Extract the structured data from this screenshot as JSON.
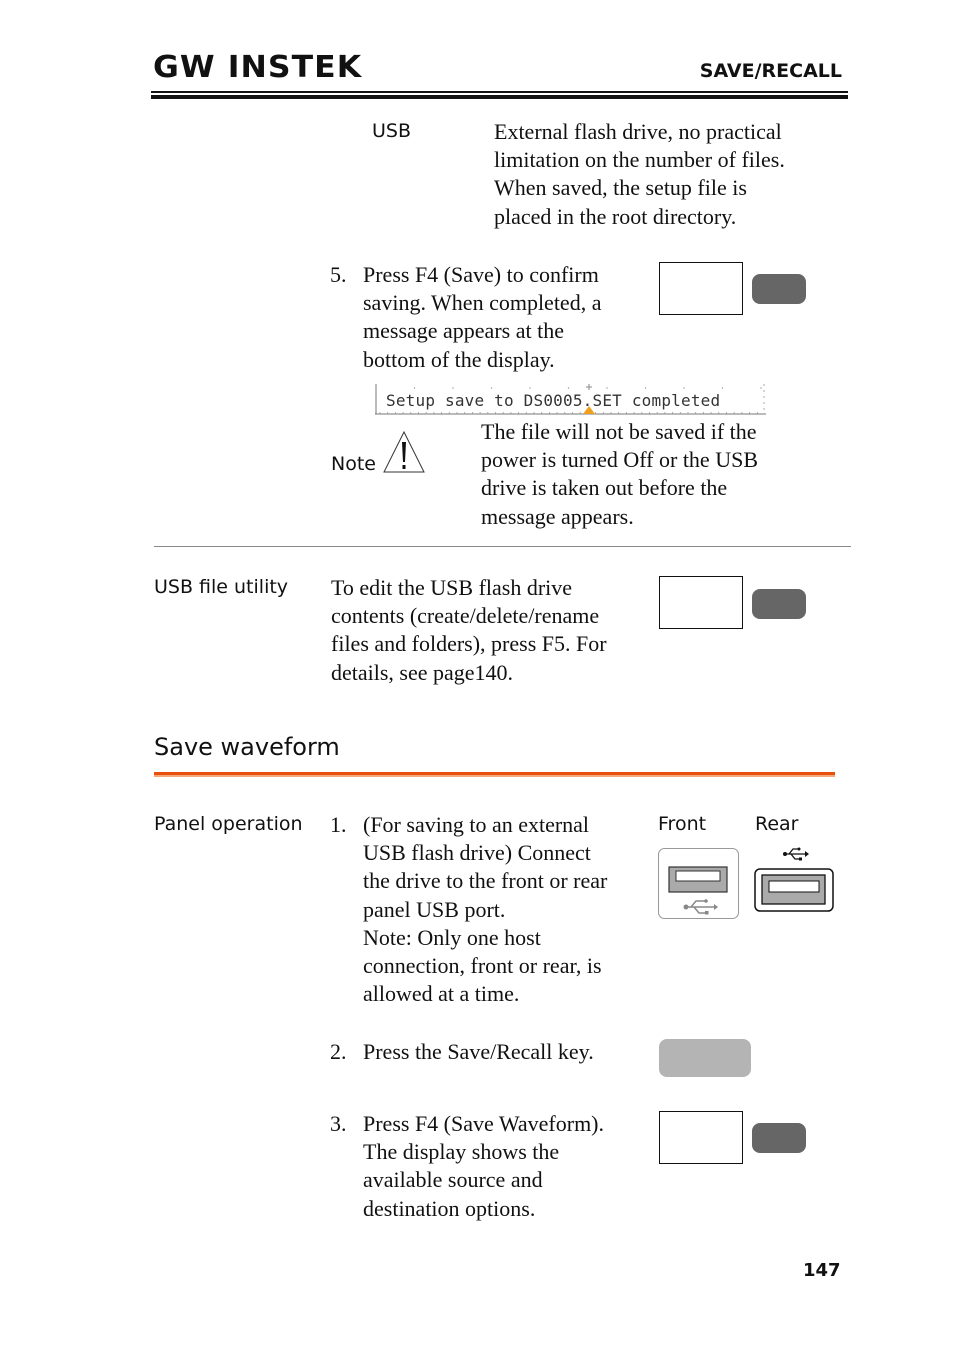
{
  "header": {
    "logo": "GW INSTEK",
    "section": "SAVE/RECALL"
  },
  "usb_row": {
    "label": "USB",
    "description": [
      "External flash drive, no practical",
      "limitation on the number of files.",
      "When saved, the setup file is",
      "placed in the root directory."
    ]
  },
  "step5": {
    "number": "5.",
    "lines": [
      "Press F4 (Save) to confirm",
      "saving. When completed, a",
      "message appears at the",
      "bottom of the display."
    ]
  },
  "display_message": "Setup save to DS0005.SET completed",
  "note": {
    "label": "Note",
    "icon": "warning-triangle-icon",
    "lines": [
      "The file will not be saved if the",
      "power is turned Off or the USB",
      "drive is taken out before the",
      "message appears."
    ]
  },
  "usb_file_utility": {
    "label": "USB file utility",
    "lines": [
      "To edit the USB flash drive",
      "contents (create/delete/rename",
      "files and folders), press F5. For",
      "details, see page140."
    ]
  },
  "save_waveform": {
    "heading": "Save waveform",
    "panel_label": "Panel operation",
    "front_label": "Front",
    "rear_label": "Rear",
    "steps": [
      {
        "number": "1.",
        "lines": [
          "(For saving to an external",
          "USB flash drive) Connect",
          "the drive to the front or rear",
          "panel USB port.",
          "Note: Only one host",
          "connection, front or rear, is",
          "allowed at a time."
        ]
      },
      {
        "number": "2.",
        "lines": [
          "Press the Save/Recall key."
        ]
      },
      {
        "number": "3.",
        "lines": [
          "Press F4 (Save Waveform).",
          "The display shows the",
          "available source and",
          "destination options."
        ]
      }
    ]
  },
  "colors": {
    "accent_orange": "#e8500e",
    "softkey_dark": "#666666",
    "key_light": "#b4b4b4",
    "marker_orange": "#f0a020"
  },
  "page_number": "147"
}
